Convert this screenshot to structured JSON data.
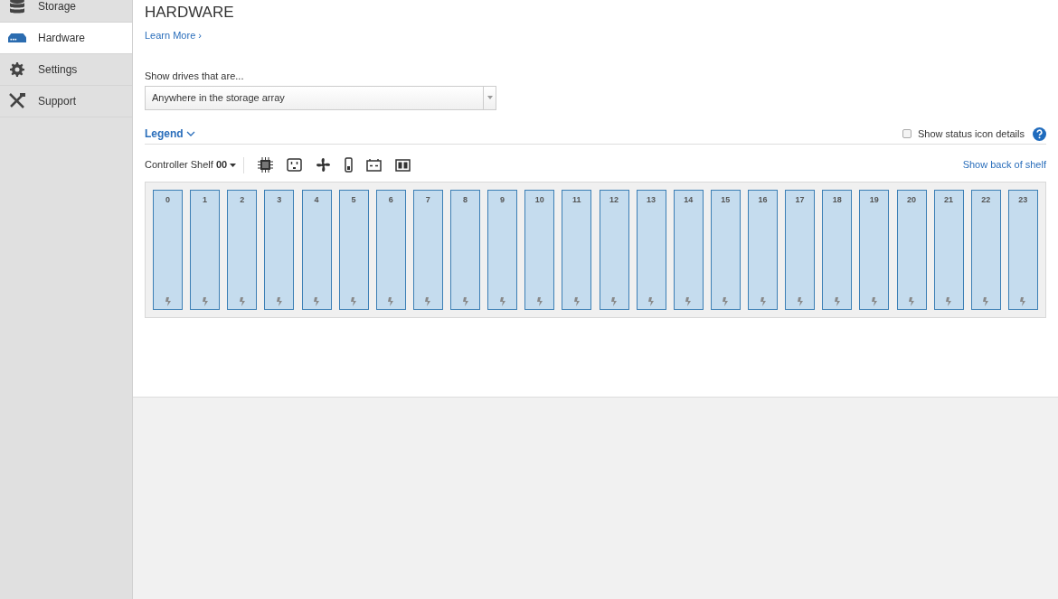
{
  "sidebar": {
    "items": [
      {
        "label": "Storage",
        "kind": "storage",
        "selected": false
      },
      {
        "label": "Hardware",
        "kind": "hardware",
        "selected": true
      },
      {
        "label": "Settings",
        "kind": "settings",
        "selected": false
      },
      {
        "label": "Support",
        "kind": "support",
        "selected": false
      }
    ]
  },
  "page": {
    "title": "HARDWARE",
    "learn_more": "Learn More",
    "learn_more_arrow": "›"
  },
  "filter": {
    "label": "Show drives that are...",
    "value": "Anywhere in the storage array"
  },
  "legend": {
    "label": "Legend",
    "status_details": {
      "label": "Show status icon details",
      "checked": false
    }
  },
  "shelf": {
    "label": "Controller Shelf",
    "number": "00",
    "show_back": "Show back of shelf",
    "drives": [
      "0",
      "1",
      "2",
      "3",
      "4",
      "5",
      "6",
      "7",
      "8",
      "9",
      "10",
      "11",
      "12",
      "13",
      "14",
      "15",
      "16",
      "17",
      "18",
      "19",
      "20",
      "21",
      "22",
      "23"
    ]
  }
}
